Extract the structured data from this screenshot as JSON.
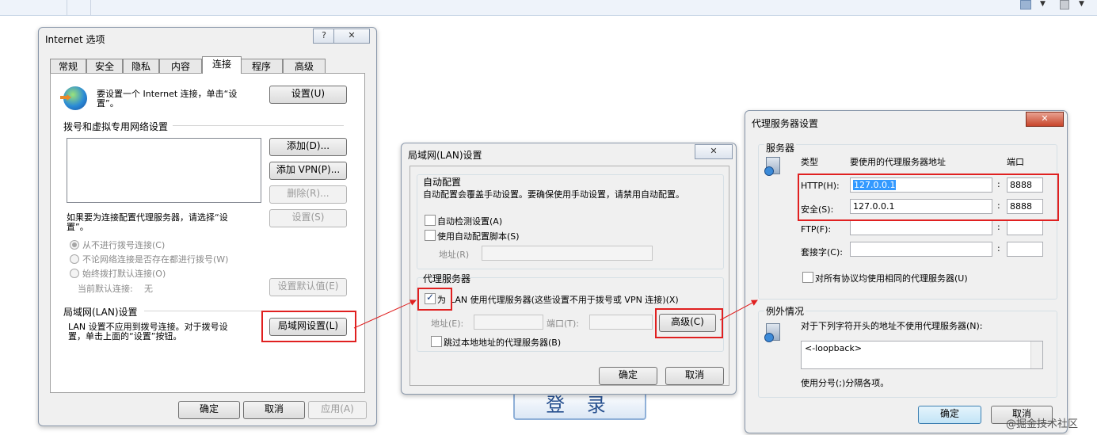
{
  "internet_options": {
    "title": "Internet 选项",
    "help": "?",
    "close": "✕",
    "tabs": [
      "常规",
      "安全",
      "隐私",
      "内容",
      "连接",
      "程序",
      "高级"
    ],
    "active_tab": "连接",
    "setup_text_line1": "要设置一个 Internet 连接，单击“设",
    "setup_text_line2": "置”。",
    "setup_button": "设置(U)",
    "dialup_section": "拨号和虚拟专用网络设置",
    "add_button": "添加(D)...",
    "add_vpn_button": "添加 VPN(P)...",
    "delete_button": "删除(R)...",
    "proxy_hint_line1": "如果要为连接配置代理服务器，请选择“设",
    "proxy_hint_line2": "置”。",
    "settings_button": "设置(S)",
    "radio1": "从不进行拨号连接(C)",
    "radio2": "不论网络连接是否存在都进行拨号(W)",
    "radio3": "始终拨打默认连接(O)",
    "current_default_label": "当前默认连接:",
    "current_default_value": "无",
    "set_default_button": "设置默认值(E)",
    "lan_section": "局域网(LAN)设置",
    "lan_text_line1": "LAN 设置不应用到拨号连接。对于拨号设",
    "lan_text_line2": "置，单击上面的“设置”按钮。",
    "lan_settings_button": "局域网设置(L)",
    "ok": "确定",
    "cancel": "取消",
    "apply": "应用(A)"
  },
  "lan_dialog": {
    "title": "局域网(LAN)设置",
    "close": "✕",
    "auto_config_header": "自动配置",
    "auto_config_desc": "自动配置会覆盖手动设置。要确保使用手动设置，请禁用自动配置。",
    "auto_detect": "自动检测设置(A)",
    "use_script": "使用自动配置脚本(S)",
    "address_label": "地址(R)",
    "proxy_header": "代理服务器",
    "use_proxy_for": "为",
    "use_proxy_rest": "LAN 使用代理服务器(这些设置不用于拨号或 VPN 连接)(X)",
    "proxy_address_label": "地址(E):",
    "port_label": "端口(T):",
    "advanced_button": "高级(C)",
    "bypass_local": "跳过本地地址的代理服务器(B)",
    "ok": "确定",
    "cancel": "取消"
  },
  "proxy_dialog": {
    "title": "代理服务器设置",
    "close": "✕",
    "servers_header": "服务器",
    "col_type": "类型",
    "col_address": "要使用的代理服务器地址",
    "col_port": "端口",
    "rows": [
      {
        "label": "HTTP(H):",
        "address": "127.0.0.1",
        "port": "8888"
      },
      {
        "label": "安全(S):",
        "address": "127.0.0.1",
        "port": "8888"
      },
      {
        "label": "FTP(F):",
        "address": "",
        "port": ""
      },
      {
        "label": "套接字(C):",
        "address": "",
        "port": ""
      }
    ],
    "same_proxy": "对所有协议均使用相同的代理服务器(U)",
    "exceptions_header": "例外情况",
    "exceptions_desc": "对于下列字符开头的地址不使用代理服务器(N):",
    "exceptions_value": "<-loopback>",
    "separator_hint": "使用分号(;)分隔各项。",
    "ok": "确定",
    "cancel": "取消"
  },
  "background": {
    "login_button": "登 录",
    "watermark": "@掘金技术社区"
  },
  "colors": {
    "highlight_border": "#e02020",
    "arrow": "#e02020",
    "selection": "#3399ff"
  }
}
